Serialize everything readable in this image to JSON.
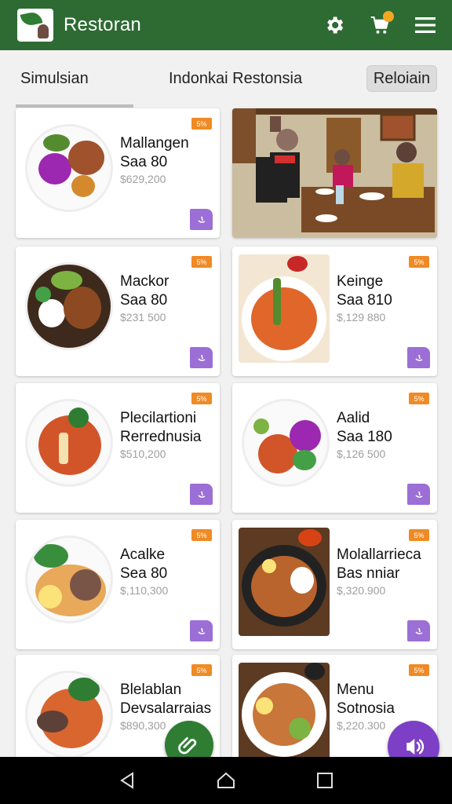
{
  "app": {
    "title": "Restoran"
  },
  "colors": {
    "appbar": "#2e6b33",
    "accent_purple": "#9b6fd6",
    "badge_orange": "#f08a24",
    "fab_green": "#2e7d32",
    "fab_purple": "#7d3fc6"
  },
  "icons": {
    "logo": "leaf-logo",
    "settings": "gear-icon",
    "cart": "cart-icon",
    "menu": "hamburger-menu-icon"
  },
  "tabs": [
    {
      "label": "Simulsian"
    },
    {
      "label": "Indonkai Restonsia"
    },
    {
      "label": "Reloiain"
    }
  ],
  "menu_items": [
    {
      "name_line1": "Mallangen",
      "name_line2": "Saa 80",
      "price": "$629,200",
      "badge": "5%"
    },
    {
      "name_line1": "Mackor",
      "name_line2": "Saa 80",
      "price": "$231 500",
      "badge": "5%"
    },
    {
      "name_line1": "Keinge",
      "name_line2": "Saa 810",
      "price": "$,129 880",
      "badge": "5%"
    },
    {
      "name_line1": "Plecilartioni",
      "name_line2": "Rerrednusia",
      "price": "$510,200",
      "badge": "5%"
    },
    {
      "name_line1": "Aalid",
      "name_line2": "Saa 180",
      "price": "$,126 500",
      "badge": "5%"
    },
    {
      "name_line1": "Acalke",
      "name_line2": "Sea 80",
      "price": "$,110,300",
      "badge": "5%"
    },
    {
      "name_line1": "Molallarrieca",
      "name_line2": "Bas nniar",
      "price": "$,320.900",
      "badge": "5%"
    },
    {
      "name_line1": "Blelablan",
      "name_line2": "Devsalarraias",
      "price": "$890,300",
      "badge": "5%"
    },
    {
      "name_line1": "Menu",
      "name_line2": "Sotnosia",
      "price": "$,220.300",
      "badge": "5%"
    }
  ]
}
